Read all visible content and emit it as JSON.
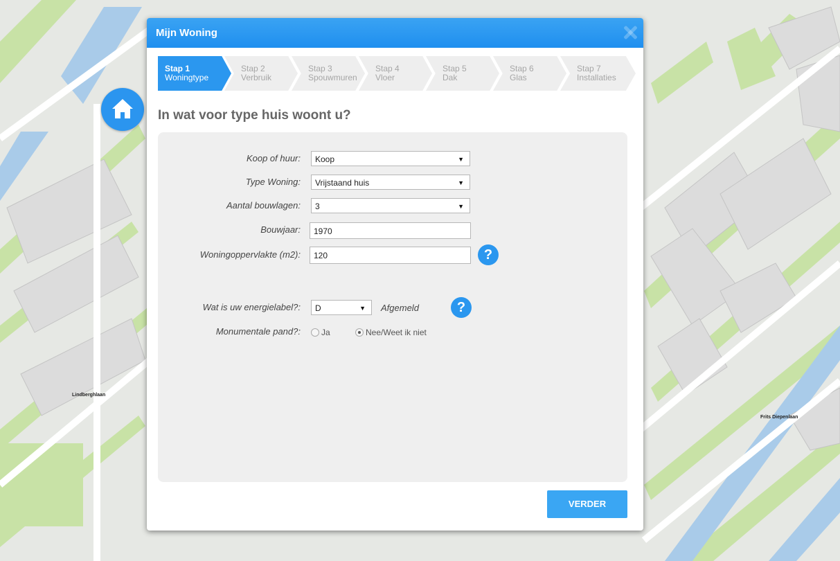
{
  "map": {
    "street_labels": [
      "Lindberghlaan",
      "Frits Diepenlaan"
    ]
  },
  "modal": {
    "title": "Mijn Woning",
    "steps": [
      {
        "top": "Stap 1",
        "bottom": "Woningtype",
        "active": true
      },
      {
        "top": "Stap 2",
        "bottom": "Verbruik"
      },
      {
        "top": "Stap 3",
        "bottom": "Spouwmuren"
      },
      {
        "top": "Stap 4",
        "bottom": "Vloer"
      },
      {
        "top": "Stap 5",
        "bottom": "Dak"
      },
      {
        "top": "Stap 6",
        "bottom": "Glas"
      },
      {
        "top": "Stap 7",
        "bottom": "Installaties"
      }
    ],
    "question": "In wat voor type huis woont u?",
    "form": {
      "koop_huur": {
        "label": "Koop of huur:",
        "value": "Koop"
      },
      "type_woning": {
        "label": "Type Woning:",
        "value": "Vrijstaand huis"
      },
      "bouwlagen": {
        "label": "Aantal bouwlagen:",
        "value": "3"
      },
      "bouwjaar": {
        "label": "Bouwjaar:",
        "value": "1970"
      },
      "oppervlakte": {
        "label": "Woningoppervlakte (m2):",
        "value": "120"
      },
      "energielabel": {
        "label": "Wat is uw energielabel?:",
        "value": "D",
        "status": "Afgemeld"
      },
      "monument": {
        "label": "Monumentale pand?:",
        "options": [
          "Ja",
          "Nee/Weet ik niet"
        ],
        "selected": "Nee/Weet ik niet"
      }
    },
    "help_glyph": "?",
    "select_arrow": "▼",
    "next_label": "VERDER"
  },
  "colors": {
    "accent": "#2b97ef",
    "button": "#3aa6f3"
  }
}
